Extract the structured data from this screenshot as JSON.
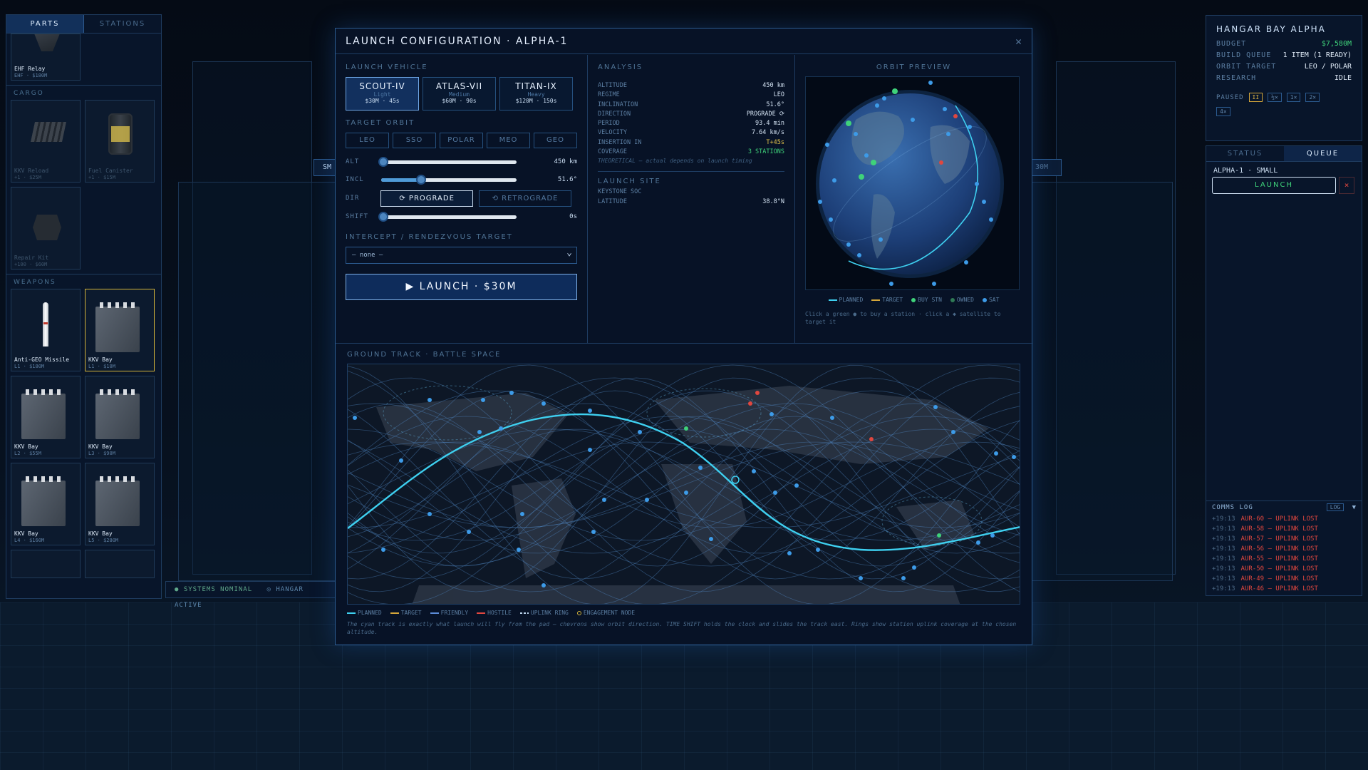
{
  "left_panel": {
    "tabs": [
      "PARTS",
      "STATIONS"
    ],
    "top_item": {
      "name": "EHF Relay",
      "cost": "EHF · $180M"
    },
    "cargo_label": "CARGO",
    "cargo": [
      {
        "name": "KKV Reload",
        "cost": "+1 · $25M"
      },
      {
        "name": "Fuel Canister",
        "cost": "+1 · $15M"
      },
      {
        "name": "Repair Kit",
        "cost": "+100 · $60M"
      }
    ],
    "weapons_label": "WEAPONS",
    "weapons": [
      {
        "name": "Anti-GEO Missile",
        "cost": "L1 · $180M",
        "kind": "missile"
      },
      {
        "name": "KKV Bay",
        "cost": "L1 · $10M",
        "kind": "bay"
      },
      {
        "name": "KKV Bay",
        "cost": "L2 · $55M",
        "kind": "bay"
      },
      {
        "name": "KKV Bay",
        "cost": "L3 · $90M",
        "kind": "bay"
      },
      {
        "name": "KKV Bay",
        "cost": "L4 · $160M",
        "kind": "bay"
      },
      {
        "name": "KKV Bay",
        "cost": "L5 · $280M",
        "kind": "bay"
      }
    ]
  },
  "modal": {
    "title": "LAUNCH CONFIGURATION · ALPHA-1",
    "launch_vehicle_label": "LAUNCH VEHICLE",
    "vehicles": [
      {
        "name": "SCOUT-IV",
        "class": "Light",
        "price": "$30M · 45s"
      },
      {
        "name": "ATLAS-VII",
        "class": "Medium",
        "price": "$60M · 90s"
      },
      {
        "name": "TITAN-IX",
        "class": "Heavy",
        "price": "$120M · 150s"
      }
    ],
    "target_orbit_label": "TARGET ORBIT",
    "orbits": [
      "LEO",
      "SSO",
      "POLAR",
      "MEO",
      "GEO"
    ],
    "sliders": {
      "alt": {
        "label": "ALT",
        "value": "450 km",
        "fraction": 0.0
      },
      "incl": {
        "label": "INCL",
        "value": "51.6°",
        "fraction": 0.28
      },
      "shift": {
        "label": "SHIFT",
        "value": "0s",
        "fraction": 0.0
      }
    },
    "dir_label": "DIR",
    "prograde": "⟳ PROGRADE",
    "retrograde": "⟲ RETROGRADE",
    "intercept_label": "INTERCEPT / RENDEZVOUS TARGET",
    "intercept_value": "— none —",
    "launch_button": "▶ LAUNCH · $30M",
    "analysis_label": "ANALYSIS",
    "analysis": [
      {
        "k": "ALTITUDE",
        "v": "450 km"
      },
      {
        "k": "REGIME",
        "v": "LEO"
      },
      {
        "k": "INCLINATION",
        "v": "51.6°"
      },
      {
        "k": "DIRECTION",
        "v": "PROGRADE ⟳"
      },
      {
        "k": "PERIOD",
        "v": "93.4 min"
      },
      {
        "k": "VELOCITY",
        "v": "7.64 km/s"
      },
      {
        "k": "INSERTION IN",
        "v": "T+45s"
      },
      {
        "k": "COVERAGE",
        "v": "3 STATIONS"
      }
    ],
    "analysis_note": "THEORETICAL — actual depends on launch timing",
    "launch_site_label": "LAUNCH SITE",
    "site_name": "KEYSTONE SOC",
    "site_lat_label": "LATITUDE",
    "site_lat": "38.8°N",
    "orbit_preview_label": "ORBIT PREVIEW",
    "orbit_legend": [
      "PLANNED",
      "TARGET",
      "BUY STN",
      "OWNED",
      "SAT"
    ],
    "orbit_hint": "Click a green ● to buy a station · click a ◆ satellite to target it",
    "ground_track_label": "GROUND TRACK · BATTLE SPACE",
    "ground_legend": [
      "PLANNED",
      "TARGET",
      "FRIENDLY",
      "HOSTILE",
      "UPLINK RING",
      "ENGAGEMENT NODE"
    ],
    "ground_note": "The cyan track is exactly what launch will fly from the pad — chevrons show orbit direction. TIME SHIFT holds the clock and slides the track east. Rings show station uplink coverage at the chosen altitude."
  },
  "hangar": {
    "title": "HANGAR BAY ALPHA",
    "rows": [
      {
        "k": "BUDGET",
        "v": "$7,580M"
      },
      {
        "k": "BUILD QUEUE",
        "v": "1 ITEM (1 READY)"
      },
      {
        "k": "ORBIT TARGET",
        "v": "LEO / POLAR"
      },
      {
        "k": "RESEARCH",
        "v": "IDLE"
      }
    ],
    "paused_label": "PAUSED",
    "speeds": [
      "II",
      "½×",
      "1×",
      "2×",
      "4×"
    ]
  },
  "queue": {
    "tabs": [
      "STATUS",
      "QUEUE"
    ],
    "item": "ALPHA-1 · SMALL",
    "launch": "LAUNCH",
    "remove": "×",
    "comms_label": "COMMS LOG",
    "log_btn": "LOG",
    "log": [
      {
        "t": "+19:13",
        "m": "AUR-60 — UPLINK LOST"
      },
      {
        "t": "+19:13",
        "m": "AUR-58 — UPLINK LOST"
      },
      {
        "t": "+19:13",
        "m": "AUR-57 — UPLINK LOST"
      },
      {
        "t": "+19:13",
        "m": "AUR-56 — UPLINK LOST"
      },
      {
        "t": "+19:13",
        "m": "AUR-55 — UPLINK LOST"
      },
      {
        "t": "+19:13",
        "m": "AUR-50 — UPLINK LOST"
      },
      {
        "t": "+19:13",
        "m": "AUR-49 — UPLINK LOST"
      },
      {
        "t": "+19:13",
        "m": "AUR-46 — UPLINK LOST"
      }
    ]
  },
  "status_bar": {
    "a": "● SYSTEMS NOMINAL",
    "b": "◎ HANGAR ACTIVE"
  },
  "bg_labels": {
    "left": "SM",
    "right": "30M"
  },
  "colors": {
    "cyan": "#3ed0f0",
    "gold": "#d4b43a",
    "green": "#3fd27a",
    "red": "#e0473f",
    "blue": "#3d9be8"
  }
}
